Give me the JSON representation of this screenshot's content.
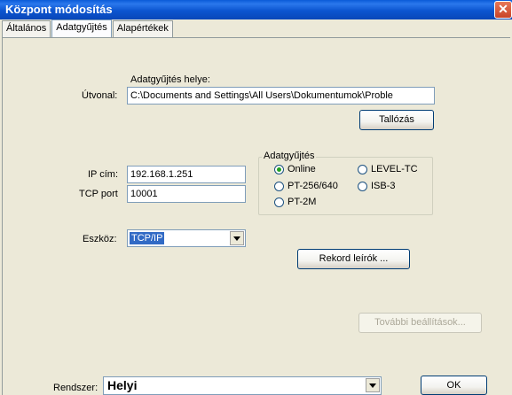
{
  "window": {
    "title": "Központ módosítás",
    "close_icon": "close-icon"
  },
  "tabs": [
    {
      "label": "Általános"
    },
    {
      "label": "Adatgyűjtés"
    },
    {
      "label": "Alapértékek"
    }
  ],
  "path_section": {
    "header": "Adatgyűjtés helye:",
    "label": "Útvonal:",
    "value": "C:\\Documents and Settings\\All Users\\Dokumentumok\\Proble",
    "browse_button": "Tallózás"
  },
  "network": {
    "ip_label": "IP cím:",
    "ip_value": "192.168.1.251",
    "port_label": "TCP port",
    "port_value": "10001"
  },
  "collection_group": {
    "title": "Adatgyűjtés",
    "options": [
      {
        "label": "Online",
        "checked": true
      },
      {
        "label": "LEVEL-TC",
        "checked": false
      },
      {
        "label": "PT-256/640",
        "checked": false
      },
      {
        "label": "ISB-3",
        "checked": false
      },
      {
        "label": "PT-2M",
        "checked": false
      }
    ]
  },
  "device": {
    "label": "Eszköz:",
    "value": "TCP/IP"
  },
  "record_button": "Rekord leírók ...",
  "more_settings_button": "További beállítások...",
  "system": {
    "label": "Rendszer:",
    "value": "Helyi"
  },
  "ok_button": "OK"
}
